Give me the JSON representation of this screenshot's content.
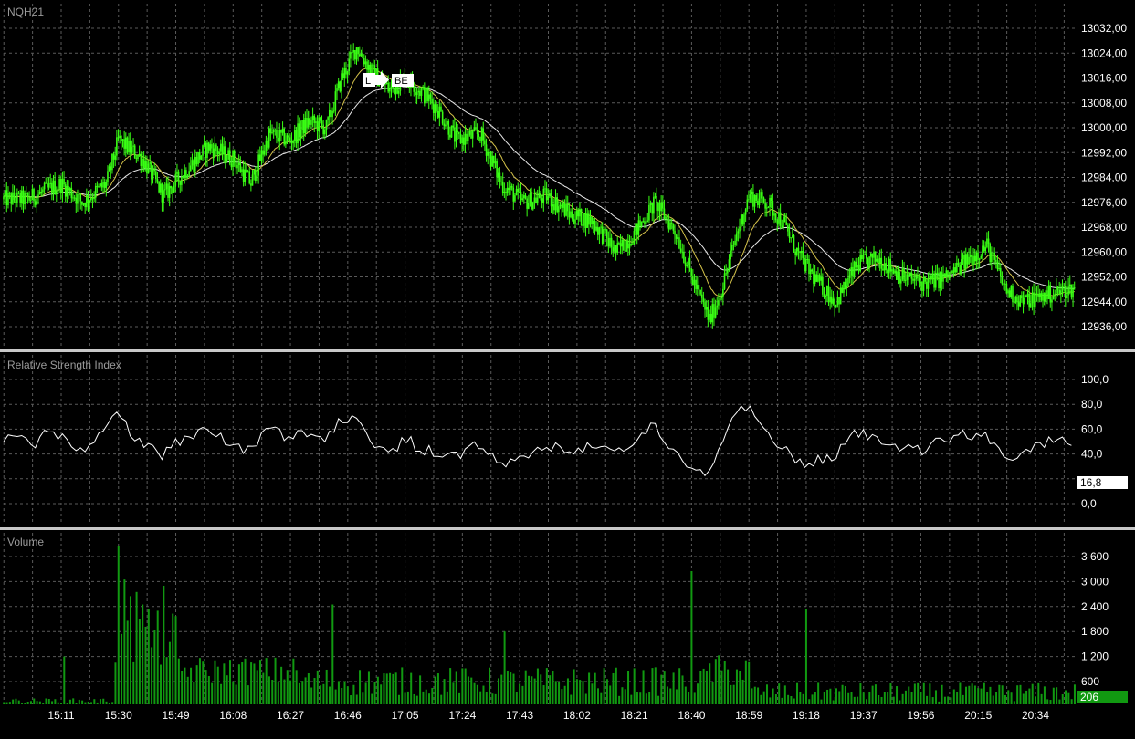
{
  "colors": {
    "background": "#000000",
    "grid": "#5a5a5a",
    "candle": "#39ff14",
    "volume": "#119911",
    "ma_fast": "#d4c24a",
    "ma_slow": "#e8e8e8",
    "rsi_line": "#ffffff",
    "separator": "#c8c8c8"
  },
  "marker": {
    "long_label": "L",
    "be_label": "BE"
  },
  "chart_data": [
    {
      "type": "candlestick",
      "title": "NQH21",
      "y_ticks": [
        "13032,00",
        "13024,00",
        "13016,00",
        "13008,00",
        "13000,00",
        "12992,00",
        "12984,00",
        "12976,00",
        "12968,00",
        "12960,00",
        "12952,00",
        "12944,00",
        "12936,00"
      ],
      "ylim": [
        12932,
        13035
      ],
      "grid": true,
      "close_keypoints": [
        [
          "15:00",
          12977
        ],
        [
          "15:11",
          12982
        ],
        [
          "15:18",
          12976
        ],
        [
          "15:26",
          12982
        ],
        [
          "15:30",
          12996
        ],
        [
          "15:38",
          12990
        ],
        [
          "15:45",
          12978
        ],
        [
          "15:52",
          12986
        ],
        [
          "16:00",
          12994
        ],
        [
          "16:08",
          12990
        ],
        [
          "16:14",
          12982
        ],
        [
          "16:20",
          12998
        ],
        [
          "16:27",
          12996
        ],
        [
          "16:33",
          13002
        ],
        [
          "16:39",
          13000
        ],
        [
          "16:44",
          13016
        ],
        [
          "16:49",
          13026
        ],
        [
          "16:54",
          13018
        ],
        [
          "17:00",
          13012
        ],
        [
          "17:05",
          13016
        ],
        [
          "17:10",
          13012
        ],
        [
          "17:16",
          13006
        ],
        [
          "17:22",
          12996
        ],
        [
          "17:30",
          12998
        ],
        [
          "17:37",
          12982
        ],
        [
          "17:44",
          12976
        ],
        [
          "17:52",
          12978
        ],
        [
          "18:00",
          12972
        ],
        [
          "18:07",
          12970
        ],
        [
          "18:15",
          12960
        ],
        [
          "18:21",
          12966
        ],
        [
          "18:28",
          12976
        ],
        [
          "18:35",
          12966
        ],
        [
          "18:40",
          12952
        ],
        [
          "18:46",
          12938
        ],
        [
          "18:50",
          12948
        ],
        [
          "18:55",
          12966
        ],
        [
          "18:59",
          12978
        ],
        [
          "19:05",
          12976
        ],
        [
          "19:10",
          12970
        ],
        [
          "19:16",
          12958
        ],
        [
          "19:22",
          12950
        ],
        [
          "19:28",
          12944
        ],
        [
          "19:35",
          12956
        ],
        [
          "19:42",
          12958
        ],
        [
          "19:50",
          12952
        ],
        [
          "19:57",
          12950
        ],
        [
          "20:05",
          12952
        ],
        [
          "20:12",
          12958
        ],
        [
          "20:18",
          12962
        ],
        [
          "20:24",
          12948
        ],
        [
          "20:30",
          12944
        ],
        [
          "20:37",
          12946
        ],
        [
          "20:45",
          12948
        ]
      ]
    },
    {
      "type": "line",
      "title": "Relative Strength Index",
      "y_ticks": [
        "100,0",
        "80,0",
        "60,0",
        "40,0",
        "0,0"
      ],
      "ylim": [
        -5,
        105
      ],
      "last_value_label": "16,8",
      "grid": true
    },
    {
      "type": "bar",
      "title": "Volume",
      "y_ticks": [
        "3 600",
        "3 000",
        "2 400",
        "1 800",
        "1 200",
        "600"
      ],
      "ylim": [
        0,
        4000
      ],
      "last_value_label": "206",
      "x_ticks": [
        "15:11",
        "15:30",
        "15:49",
        "16:08",
        "16:27",
        "16:46",
        "17:05",
        "17:24",
        "17:43",
        "18:02",
        "18:21",
        "18:40",
        "18:59",
        "19:18",
        "19:37",
        "19:56",
        "20:15",
        "20:34"
      ],
      "spikes": [
        [
          "15:30",
          3850
        ],
        [
          "15:32",
          3050
        ],
        [
          "15:34",
          2650
        ],
        [
          "15:36",
          2750
        ],
        [
          "15:38",
          2450
        ],
        [
          "15:40",
          2350
        ],
        [
          "15:45",
          2900
        ],
        [
          "15:30",
          3850
        ],
        [
          "16:41",
          2450
        ],
        [
          "17:38",
          1800
        ],
        [
          "18:40",
          3250
        ],
        [
          "19:18",
          2350
        ],
        [
          "15:12",
          1200
        ]
      ]
    }
  ]
}
